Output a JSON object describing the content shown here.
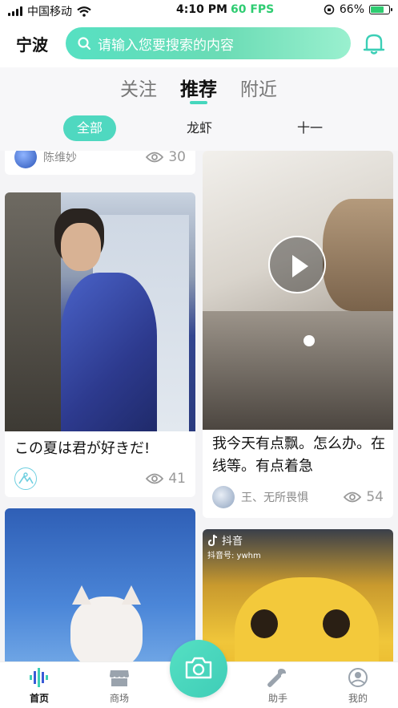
{
  "status_bar": {
    "carrier": "中国移动",
    "time": "4:10 PM",
    "fps": "60 FPS",
    "battery": "66%"
  },
  "header": {
    "city": "宁波",
    "search_placeholder": "请输入您要搜索的内容",
    "bell_icon": "bell-icon"
  },
  "tabs": [
    {
      "label": "关注",
      "active": false
    },
    {
      "label": "推荐",
      "active": true
    },
    {
      "label": "附近",
      "active": false
    }
  ],
  "chips": [
    {
      "label": "全部",
      "active": true
    },
    {
      "label": "龙虾",
      "active": false
    },
    {
      "label": "十一",
      "active": false
    }
  ],
  "feed": {
    "left": [
      {
        "author": "陈维妙",
        "views": "30"
      },
      {
        "title": "この夏は君が好きだ!",
        "views": "41"
      },
      {
        "views": ""
      }
    ],
    "right": [
      {
        "title": "我今天有点飘。怎么办。在线等。有点着急",
        "author": "王、无所畏惧",
        "views": "54",
        "is_video": true
      },
      {
        "watermark": "抖音",
        "watermark_id": "抖音号: ywhm"
      }
    ]
  },
  "bottom_nav": {
    "items": [
      {
        "label": "首页",
        "icon": "home-wave-icon",
        "active": true
      },
      {
        "label": "商场",
        "icon": "shop-icon",
        "active": false
      },
      {
        "label": "助手",
        "icon": "wrench-icon",
        "active": false
      },
      {
        "label": "我的",
        "icon": "profile-icon",
        "active": false
      }
    ],
    "center_icon": "camera-icon"
  },
  "colors": {
    "accent": "#4fd8c0",
    "fps": "#2ecc71"
  }
}
